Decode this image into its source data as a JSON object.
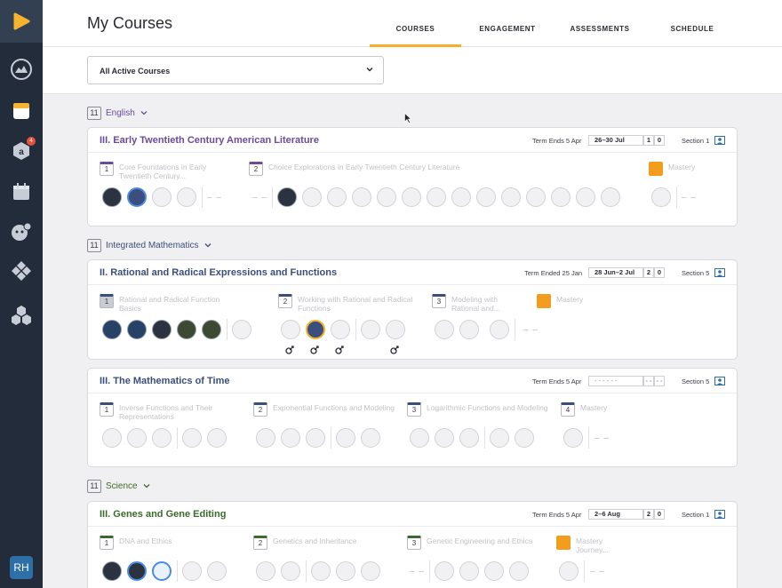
{
  "colors": {
    "sidebar": "#232c3b",
    "accent_tab": "#f3b02a",
    "english": "#6b4a9e",
    "math": "#3a4e7a",
    "science": "#3c6a2a",
    "mastery": "#f29d1e"
  },
  "sidebar": {
    "icons": [
      "logo-icon",
      "dashboard-icon",
      "courses-icon",
      "assignments-icon",
      "calendar-icon",
      "chat-icon",
      "strategy-icon",
      "modules-icon"
    ],
    "badge": "4",
    "avatar": "RH"
  },
  "header": {
    "title": "My Courses",
    "tabs": [
      "COURSES",
      "ENGAGEMENT",
      "ASSESSMENTS",
      "SCHEDULE"
    ]
  },
  "filter": {
    "selected": "All Active Courses"
  },
  "groups": [
    {
      "grade": "11",
      "name": "English"
    },
    {
      "grade": "11",
      "name": "Integrated Mathematics"
    },
    {
      "grade": "11",
      "name": "Science"
    }
  ],
  "courses": [
    {
      "title": "III. Early Twentieth Century American Literature",
      "term": "Term Ends 5 Apr",
      "dates": "26–30 Jul",
      "count_a": "1",
      "count_b": "0",
      "section": "Section 1",
      "units": [
        {
          "num": "1",
          "title": "Core Foundations in Early Twentieth Century..."
        },
        {
          "num": "2",
          "title": "Choice Explorations in Early Twentieth Century Literature"
        },
        {
          "num": "",
          "title": "Mastery"
        }
      ]
    },
    {
      "title": "II. Rational and Radical Expressions and Functions",
      "term": "Term Ended 25 Jan",
      "dates": "28 Jun–2 Jul",
      "count_a": "2",
      "count_b": "0",
      "section": "Section 5",
      "units": [
        {
          "num": "1",
          "title": "Rational and Radical Function Basics"
        },
        {
          "num": "2",
          "title": "Working with Rational and Radical Functions"
        },
        {
          "num": "3",
          "title": "Modeling with Rational and..."
        },
        {
          "num": "",
          "title": "Mastery"
        }
      ]
    },
    {
      "title": "III. The Mathematics of Time",
      "term": "Term Ends 5 Apr",
      "dates": "- - - - - -",
      "count_a": "- -",
      "count_b": "- -",
      "section": "Section 5",
      "units": [
        {
          "num": "1",
          "title": "Inverse Functions and Their Representations"
        },
        {
          "num": "2",
          "title": "Exponential Functions and Modeling"
        },
        {
          "num": "3",
          "title": "Logarithmic Functions and Modeling"
        },
        {
          "num": "4",
          "title": "Mastery"
        }
      ]
    },
    {
      "title": "III. Genes and Gene Editing",
      "term": "Term Ends 5 Apr",
      "dates": "2–6 Aug",
      "count_a": "2",
      "count_b": "0",
      "section": "Section 1",
      "units": [
        {
          "num": "1",
          "title": "DNA and Ethics"
        },
        {
          "num": "2",
          "title": "Genetics and Inheritance"
        },
        {
          "num": "3",
          "title": "Genetic Engineering and Ethics"
        },
        {
          "num": "",
          "title": "Mastery Journey..."
        }
      ]
    }
  ],
  "placeholder_dash": "– –"
}
